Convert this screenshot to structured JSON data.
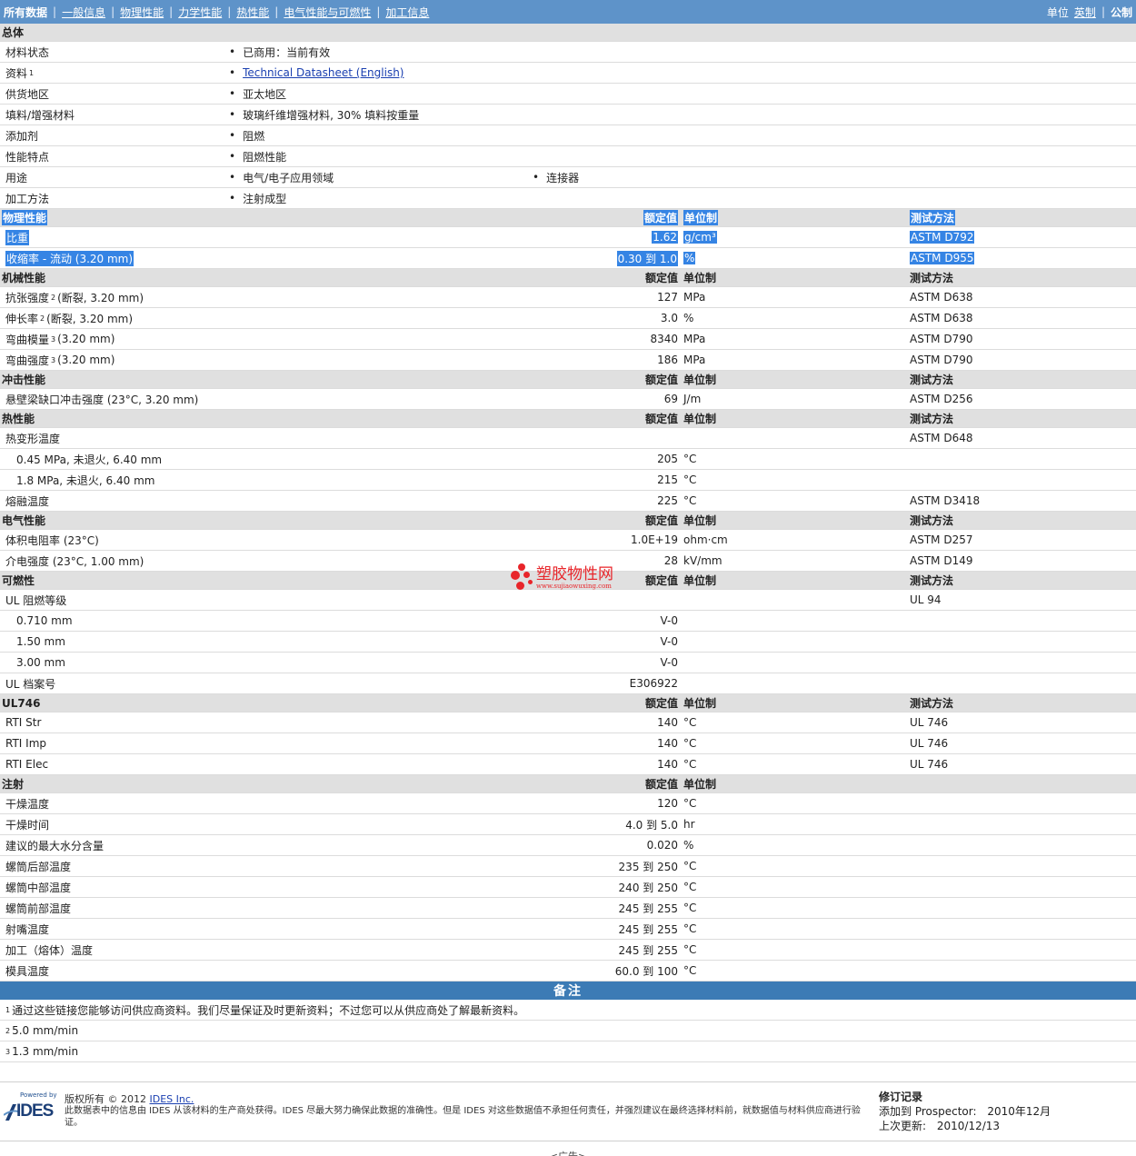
{
  "topbar": {
    "nav": [
      "所有数据",
      "一般信息",
      "物理性能",
      "力学性能",
      "热性能",
      "电气性能与可燃性",
      "加工信息"
    ],
    "units_label": "单位",
    "unit_options": [
      "英制",
      "公制"
    ]
  },
  "general": {
    "title": "总体",
    "rows": [
      {
        "label": "材料状态",
        "values": [
          "已商用：当前有效"
        ]
      },
      {
        "label": "资料",
        "sup": "1",
        "link": "Technical Datasheet (English)"
      },
      {
        "label": "供货地区",
        "values": [
          "亚太地区"
        ]
      },
      {
        "label": "填料/增强材料",
        "values": [
          "玻璃纤维增强材料, 30% 填料按重量"
        ]
      },
      {
        "label": "添加剂",
        "values": [
          "阻燃"
        ]
      },
      {
        "label": "性能特点",
        "values": [
          "阻燃性能"
        ]
      },
      {
        "label": "用途",
        "values": [
          "电气/电子应用领域",
          "连接器"
        ]
      },
      {
        "label": "加工方法",
        "values": [
          "注射成型"
        ]
      }
    ]
  },
  "col_headers": {
    "nominal": "额定值",
    "unit": "单位制",
    "test": "测试方法"
  },
  "sections": [
    {
      "title": "物理性能",
      "selected": true,
      "has_test": true,
      "rows": [
        {
          "label": "比重",
          "value": "1.62",
          "unit": "g/cm³",
          "test": "ASTM D792"
        },
        {
          "label": "收缩率 - 流动 (3.20 mm)",
          "value": "0.30 到 1.0",
          "unit": "%",
          "test": "ASTM D955"
        }
      ]
    },
    {
      "title": "机械性能",
      "has_test": true,
      "rows": [
        {
          "label": "抗张强度",
          "sup": "2",
          "suffix": "(断裂, 3.20 mm)",
          "value": "127",
          "unit": "MPa",
          "test": "ASTM D638"
        },
        {
          "label": "伸长率",
          "sup": "2",
          "suffix": "(断裂, 3.20 mm)",
          "value": "3.0",
          "unit": "%",
          "test": "ASTM D638"
        },
        {
          "label": "弯曲模量",
          "sup": "3",
          "suffix": "(3.20 mm)",
          "value": "8340",
          "unit": "MPa",
          "test": "ASTM D790"
        },
        {
          "label": "弯曲强度",
          "sup": "3",
          "suffix": "(3.20 mm)",
          "value": "186",
          "unit": "MPa",
          "test": "ASTM D790"
        }
      ]
    },
    {
      "title": "冲击性能",
      "has_test": true,
      "rows": [
        {
          "label": "悬壁梁缺口冲击强度 (23°C, 3.20 mm)",
          "value": "69",
          "unit": "J/m",
          "test": "ASTM D256"
        }
      ]
    },
    {
      "title": "热性能",
      "has_test": true,
      "rows": [
        {
          "label": "热变形温度",
          "value": "",
          "unit": "",
          "test": "ASTM D648"
        },
        {
          "label": "0.45 MPa, 未退火, 6.40 mm",
          "indent": true,
          "value": "205",
          "unit": "°C",
          "test": ""
        },
        {
          "label": "1.8 MPa, 未退火, 6.40 mm",
          "indent": true,
          "value": "215",
          "unit": "°C",
          "test": ""
        },
        {
          "label": "熔融温度",
          "value": "225",
          "unit": "°C",
          "test": "ASTM D3418"
        }
      ]
    },
    {
      "title": "电气性能",
      "has_test": true,
      "rows": [
        {
          "label": "体积电阻率 (23°C)",
          "value": "1.0E+19",
          "unit": "ohm·cm",
          "test": "ASTM D257"
        },
        {
          "label": "介电强度 (23°C, 1.00 mm)",
          "value": "28",
          "unit": "kV/mm",
          "test": "ASTM D149"
        }
      ]
    },
    {
      "title": "可燃性",
      "has_test": true,
      "rows": [
        {
          "label": "UL 阻燃等级",
          "value": "",
          "unit": "",
          "test": "UL 94"
        },
        {
          "label": "0.710 mm",
          "indent": true,
          "value": "V-0",
          "unit": "",
          "test": ""
        },
        {
          "label": "1.50 mm",
          "indent": true,
          "value": "V-0",
          "unit": "",
          "test": ""
        },
        {
          "label": "3.00 mm",
          "indent": true,
          "value": "V-0",
          "unit": "",
          "test": ""
        },
        {
          "label": "UL 档案号",
          "value": "E306922",
          "unit": "",
          "test": ""
        }
      ]
    },
    {
      "title": "UL746",
      "has_test": true,
      "rows": [
        {
          "label": "RTI Str",
          "value": "140",
          "unit": "°C",
          "test": "UL 746"
        },
        {
          "label": "RTI Imp",
          "value": "140",
          "unit": "°C",
          "test": "UL 746"
        },
        {
          "label": "RTI Elec",
          "value": "140",
          "unit": "°C",
          "test": "UL 746"
        }
      ]
    },
    {
      "title": "注射",
      "has_test": false,
      "rows": [
        {
          "label": "干燥温度",
          "value": "120",
          "unit": "°C",
          "test": ""
        },
        {
          "label": "干燥时间",
          "value": "4.0 到 5.0",
          "unit": "hr",
          "test": ""
        },
        {
          "label": "建议的最大水分含量",
          "value": "0.020",
          "unit": "%",
          "test": ""
        },
        {
          "label": "螺筒后部温度",
          "value": "235 到 250",
          "unit": "°C",
          "test": ""
        },
        {
          "label": "螺筒中部温度",
          "value": "240 到 250",
          "unit": "°C",
          "test": ""
        },
        {
          "label": "螺筒前部温度",
          "value": "245 到 255",
          "unit": "°C",
          "test": ""
        },
        {
          "label": "射嘴温度",
          "value": "245 到 255",
          "unit": "°C",
          "test": ""
        },
        {
          "label": "加工（熔体）温度",
          "value": "245 到 255",
          "unit": "°C",
          "test": ""
        },
        {
          "label": "模具温度",
          "value": "60.0 到 100",
          "unit": "°C",
          "test": ""
        }
      ]
    }
  ],
  "notes": {
    "title": "备注",
    "items": [
      {
        "num": "1",
        "text": "通过这些链接您能够访问供应商资料。我们尽量保证及时更新资料；不过您可以从供应商处了解最新资料。"
      },
      {
        "num": "2",
        "text": "5.0 mm/min"
      },
      {
        "num": "3",
        "text": "1.3 mm/min"
      }
    ]
  },
  "footer": {
    "logo_small": "Powered by",
    "logo_text": "IDES",
    "copyright_prefix": "版权所有 © 2012",
    "copyright_link": "IDES Inc.",
    "disclaimer": "此数据表中的信息由 IDES 从该材料的生产商处获得。IDES 尽最大努力确保此数据的准确性。但是 IDES 对这些数据值不承担任何责任，并强烈建议在最终选择材料前，就数据值与材料供应商进行验证。",
    "revision_title": "修订记录",
    "added_label": "添加到 Prospector:",
    "added_value": "2010年12月",
    "updated_label": "上次更新:",
    "updated_value": "2010/12/13",
    "ad": "<广告>"
  },
  "watermark": {
    "text": "塑胶物性网",
    "url": "www.sujiaowuxing.com",
    "color": "#e8252a"
  },
  "colors": {
    "topbar": "#5e93c9",
    "header_row": "#e0e0e0",
    "notes_bar": "#3c7bb5",
    "selection": "#3584e4"
  }
}
